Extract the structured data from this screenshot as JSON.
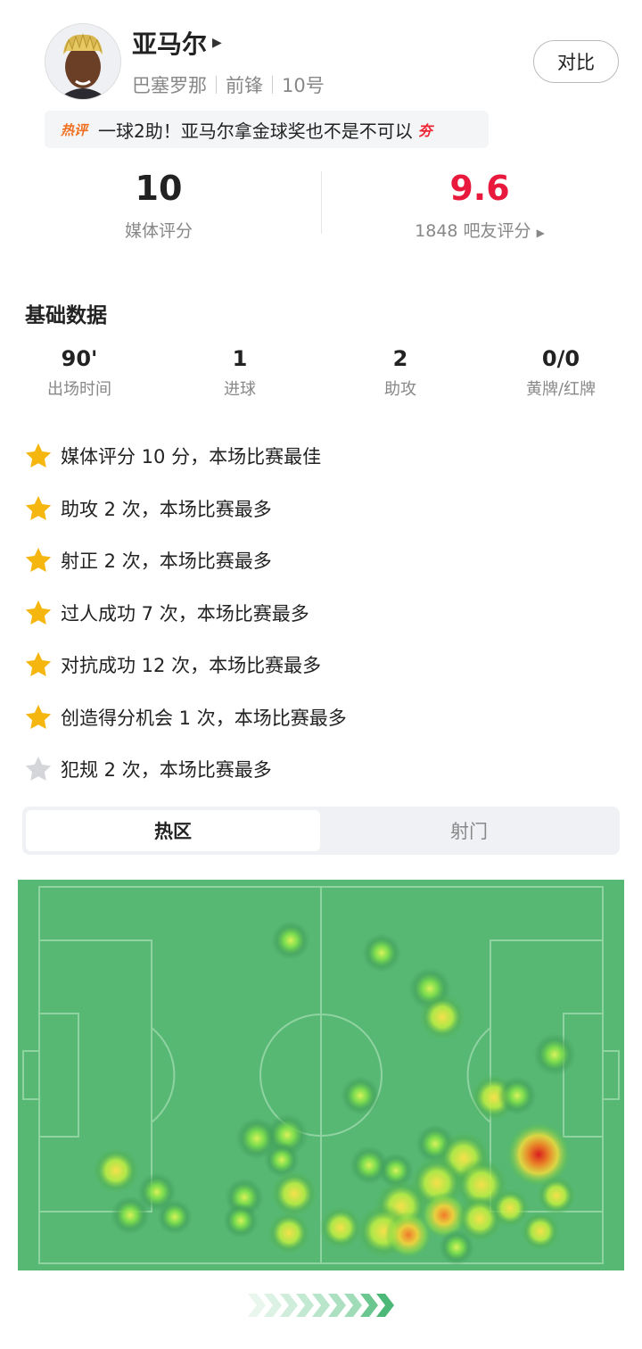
{
  "player": {
    "name": "亚马尔",
    "club": "巴塞罗那",
    "position": "前锋",
    "number": "10号",
    "compare_button": "对比"
  },
  "hot_comment": {
    "tag": "热评",
    "text": "一球2助！亚马尔拿金球奖也不是不可以",
    "emphasis": "夯"
  },
  "ratings": {
    "media_score": "10",
    "media_label": "媒体评分",
    "fan_score": "9.6",
    "fan_label": "1848 吧友评分",
    "fan_score_color": "#e8193c"
  },
  "basic": {
    "title": "基础数据",
    "stats": [
      {
        "value": "90'",
        "label": "出场时间"
      },
      {
        "value": "1",
        "label": "进球"
      },
      {
        "value": "2",
        "label": "助攻"
      },
      {
        "value": "0/0",
        "label": "黄牌/红牌"
      }
    ]
  },
  "highlights": [
    {
      "text": "媒体评分 10 分，本场比赛最佳",
      "icon": "gold-star-icon"
    },
    {
      "text": "助攻 2 次，本场比赛最多",
      "icon": "gold-star-icon"
    },
    {
      "text": "射正 2 次，本场比赛最多",
      "icon": "gold-star-icon"
    },
    {
      "text": "过人成功 7 次，本场比赛最多",
      "icon": "gold-star-icon"
    },
    {
      "text": "对抗成功 12 次，本场比赛最多",
      "icon": "gold-star-icon"
    },
    {
      "text": "创造得分机会 1 次，本场比赛最多",
      "icon": "gold-star-icon"
    },
    {
      "text": "犯规 2 次，本场比赛最多",
      "icon": "grey-star-icon"
    }
  ],
  "tabs": {
    "active": "热区",
    "other": "射门"
  },
  "colors": {
    "pitch": "#57b874",
    "star_gold": "#f5b70f",
    "star_grey": "#d4d6da"
  }
}
